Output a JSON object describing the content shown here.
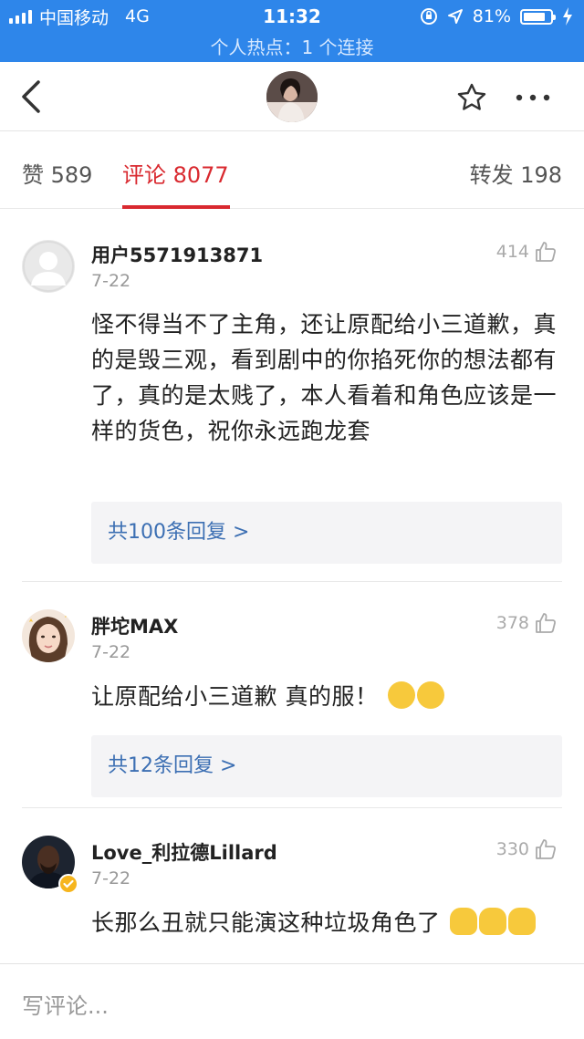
{
  "status_bar": {
    "carrier": "中国移动",
    "network": "4G",
    "time": "11:32",
    "battery": "81%",
    "battery_level": 0.81,
    "hotspot": "个人热点：1 个连接"
  },
  "tabs": {
    "likes": "赞 589",
    "comments": "评论 8077",
    "reposts": "转发 198",
    "active": "comments"
  },
  "comments": [
    {
      "username": "用户5571913871",
      "date": "7-22",
      "likes": "414",
      "content": "怪不得当不了主角，还让原配给小三道歉，真的是毁三观，看到剧中的你掐死你的想法都有了，真的是太贱了，本人看着和角色应该是一样的货色，祝你永远跑龙套",
      "replies": "共100条回复 >"
    },
    {
      "username": "胖坨MAX",
      "date": "7-22",
      "likes": "378",
      "content": "让原配给小三道歉 真的服！",
      "replies": "共12条回复 >"
    },
    {
      "username": "Love_利拉德Lillard",
      "date": "7-22",
      "likes": "330",
      "content": "长那么丑就只能演这种垃圾角色了"
    }
  ],
  "input": {
    "placeholder": "写评论..."
  },
  "colors": {
    "status_bar": "#2e86ea",
    "accent_red": "#d9292f",
    "reply_link": "#3c6fb3"
  }
}
